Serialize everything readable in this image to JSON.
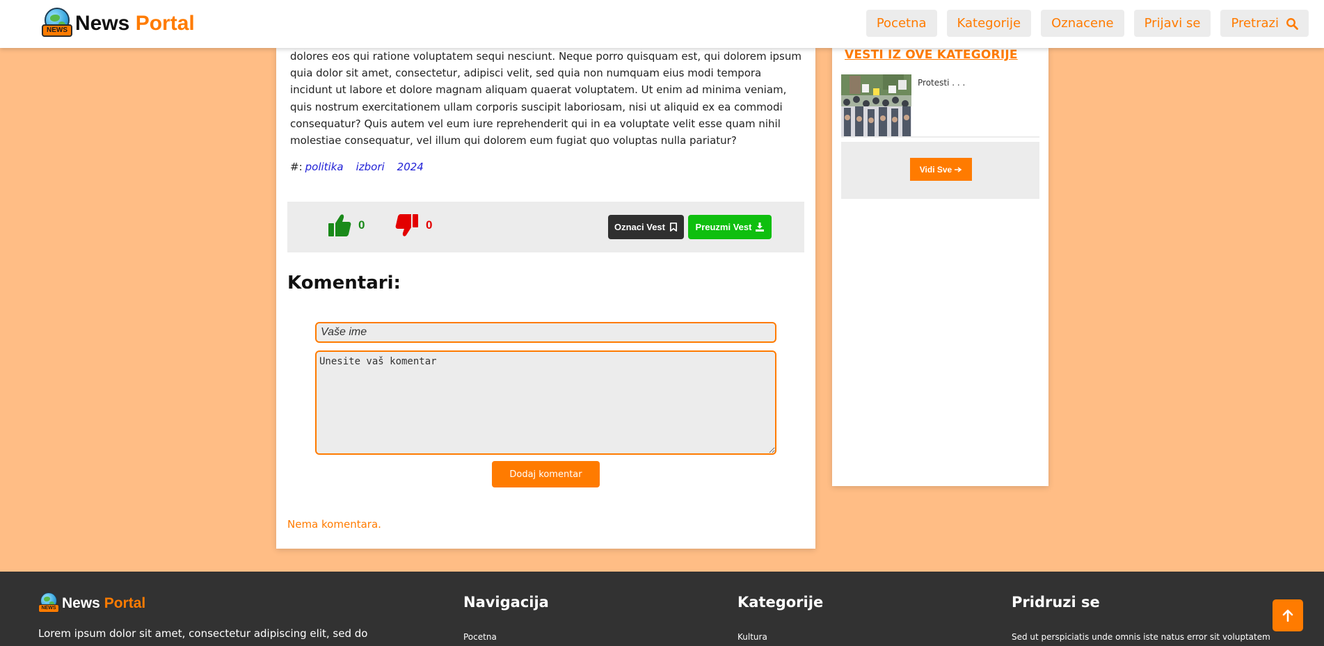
{
  "header": {
    "logo_badge": "NEWS",
    "logo_word1": "News",
    "logo_word2": "Portal",
    "nav": {
      "home": "Pocetna",
      "categories": "Kategorije",
      "marked": "Oznacene",
      "login": "Prijavi se",
      "search": "Pretrazi"
    }
  },
  "article": {
    "body_text": "dolores eos qui ratione voluptatem sequi nesciunt. Neque porro quisquam est, qui dolorem ipsum quia dolor sit amet, consectetur, adipisci velit, sed quia non numquam eius modi tempora incidunt ut labore et dolore magnam aliquam quaerat voluptatem. Ut enim ad minima veniam, quis nostrum exercitationem ullam corporis suscipit laboriosam, nisi ut aliquid ex ea commodi consequatur? Quis autem vel eum iure reprehenderit qui in ea voluptate velit esse quam nihil molestiae consequatur, vel illum qui dolorem eum fugiat quo voluptas nulla pariatur?",
    "tags_prefix": "#:",
    "tags": [
      "politika",
      "izbori",
      "2024"
    ],
    "likes": "0",
    "dislikes": "0",
    "mark_button": "Oznaci Vest",
    "download_button": "Preuzmi Vest"
  },
  "comments": {
    "title": "Komentari:",
    "name_placeholder": "Vaše ime",
    "comment_placeholder": "Unesite vaš komentar",
    "submit_label": "Dodaj komentar",
    "empty_text": "Nema komentara."
  },
  "sidebar": {
    "title": "VESTI IZ OVE KATEGORIJE",
    "item_caption": "Protesti . . .",
    "see_all": "Vidi Sve"
  },
  "footer": {
    "logo_badge": "NEWS",
    "logo_word1": "News",
    "logo_word2": "Portal",
    "description": "Lorem ipsum dolor sit amet, consectetur adipiscing elit, sed do",
    "nav_title": "Navigacija",
    "nav_first": "Pocetna",
    "cat_title": "Kategorije",
    "cat_first": "Kultura",
    "join_title": "Pridruzi se",
    "join_text": "Sed ut perspiciatis unde omnis iste natus error sit voluptatem"
  },
  "colors": {
    "accent": "#ff7b00",
    "background": "#ffbd85",
    "footer": "#323232",
    "like": "#1a8a1a",
    "dislike": "#e30000",
    "download": "#0fbf0f"
  },
  "icons": {
    "search": "search-icon",
    "like": "thumbs-up-icon",
    "dislike": "thumbs-down-icon",
    "bookmark": "bookmark-icon",
    "download": "download-icon",
    "arrow": "arrow-right-icon",
    "top": "arrow-up-icon"
  }
}
